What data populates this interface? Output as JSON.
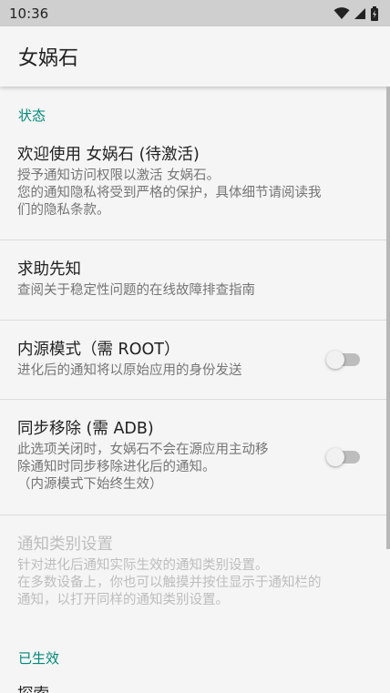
{
  "status_bar": {
    "time": "10:36",
    "icons": [
      "wifi-icon",
      "cellular-signal-icon",
      "battery-icon"
    ]
  },
  "app_bar": {
    "title": "女娲石"
  },
  "sections": {
    "status": {
      "header": "状态",
      "activation": {
        "title": "欢迎使用 女娲石 (待激活)",
        "summary_lines": [
          "授予通知访问权限以激活 女娲石。",
          "您的通知隐私将受到严格的保护，具体细节请阅读我",
          "们的隐私条款。"
        ]
      },
      "help": {
        "title": "求助先知",
        "summary": "查阅关于稳定性问题的在线故障排查指南"
      },
      "inner_mode": {
        "title": "内源模式（需 ROOT）",
        "summary": "进化后的通知将以原始应用的身份发送",
        "enabled": false
      },
      "sync_remove": {
        "title": "同步移除 (需 ADB)",
        "summary_lines": [
          "此选项关闭时，女娲石不会在源应用主动移",
          "除通知时同步移除进化后的通知。",
          "（内源模式下始终生效）"
        ],
        "enabled": false
      },
      "channel_settings": {
        "title": "通知类别设置",
        "summary_lines": [
          "针对进化后通知实际生效的通知类别设置。",
          "在多数设备上，你也可以触摸并按住显示于通知栏的",
          "通知，以打开同样的通知类别设置。"
        ],
        "disabled": true
      }
    },
    "active": {
      "header": "已生效",
      "first_item_title_partial": "探索"
    }
  },
  "colors": {
    "accent": "#00897b",
    "status_bar": "#cfcfcf",
    "background": "#f5f5f5"
  }
}
